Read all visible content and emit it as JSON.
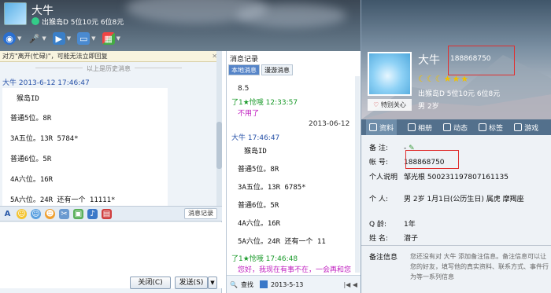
{
  "header": {
    "title": "大牛",
    "status_line": "出猴岛D   5位10元 6位8元"
  },
  "chat": {
    "notice": "对方\"离开(忙碌)\"，可能无法立即回复",
    "history_separator": "以上是历史消息",
    "message_header": "大牛 2013-6-12 17:46:47",
    "image_lines": [
      "猴岛ID",
      "普通5位。8R",
      "3A五位。13R     5784*",
      "普通6位。5R",
      "4A六位。16R",
      "5A六位。24R     还有一个  11111*"
    ],
    "record_button": "消息记录",
    "close_button": "关闭(C)",
    "send_button": "发送(S)"
  },
  "history": {
    "title": "消息记录",
    "tabs": [
      "本地消息",
      "漫游消息"
    ],
    "lines": [
      {
        "text": "8.5",
        "color": "#222"
      },
      {
        "text": "了1★怆哦  12:33:57",
        "color": "#1a9a2a"
      },
      {
        "text": "不用了",
        "color": "#c020c0"
      },
      {
        "text": "2013-06-12",
        "color": "#333"
      },
      {
        "text": "大牛 17:46:47",
        "color": "#2752a8"
      }
    ],
    "image_lines": [
      "猴岛ID",
      "普通5位。8R",
      "3A五位。13R      6785*",
      "普通6位。5R",
      "4A六位。16R",
      "5A六位。24R    还有一个  11"
    ],
    "tail_lines": [
      {
        "text": "了1★怆哦  17:46:48",
        "color": "#1a9a2a"
      },
      {
        "text": "您好，我现在有事不在，一会再和您",
        "color": "#c020c0"
      }
    ],
    "search_label": "查找",
    "date_value": "2013-5-13"
  },
  "profile": {
    "name": "大牛",
    "qq_top": "188868750",
    "status": "出猴岛D   5位10元 6位8元",
    "gender_age_top": "男  2岁",
    "special_care": "特别关心",
    "tabs": [
      "资料",
      "相册",
      "动态",
      "标签",
      "游戏"
    ],
    "rows": [
      {
        "label": "备    注:",
        "value": "-"
      },
      {
        "label": "帐    号:",
        "value": "188868750"
      },
      {
        "label": "个人说明",
        "value": "邹光根 500231197807161135"
      },
      {
        "label": "个    人:",
        "value": "男   2岁   1月1日(公历生日)   属虎   摩羯座"
      },
      {
        "label": "Q     龄:",
        "value": "1年"
      },
      {
        "label": "姓    名:",
        "value": "潜子"
      }
    ],
    "remark_label": "备注信息",
    "remark_text": "您还没有对 大牛 添加备注信息。备注信息可以让您的好友，填写他的真实资料、联系方式、事件行为等一系列信息"
  },
  "colors": {
    "accent": "#2752a8",
    "highlight": "#e03030",
    "header_bg": "#4f6070"
  },
  "icons": [
    "qq-icon",
    "mic-icon",
    "video-icon",
    "screen-icon",
    "app-grid-icon"
  ]
}
